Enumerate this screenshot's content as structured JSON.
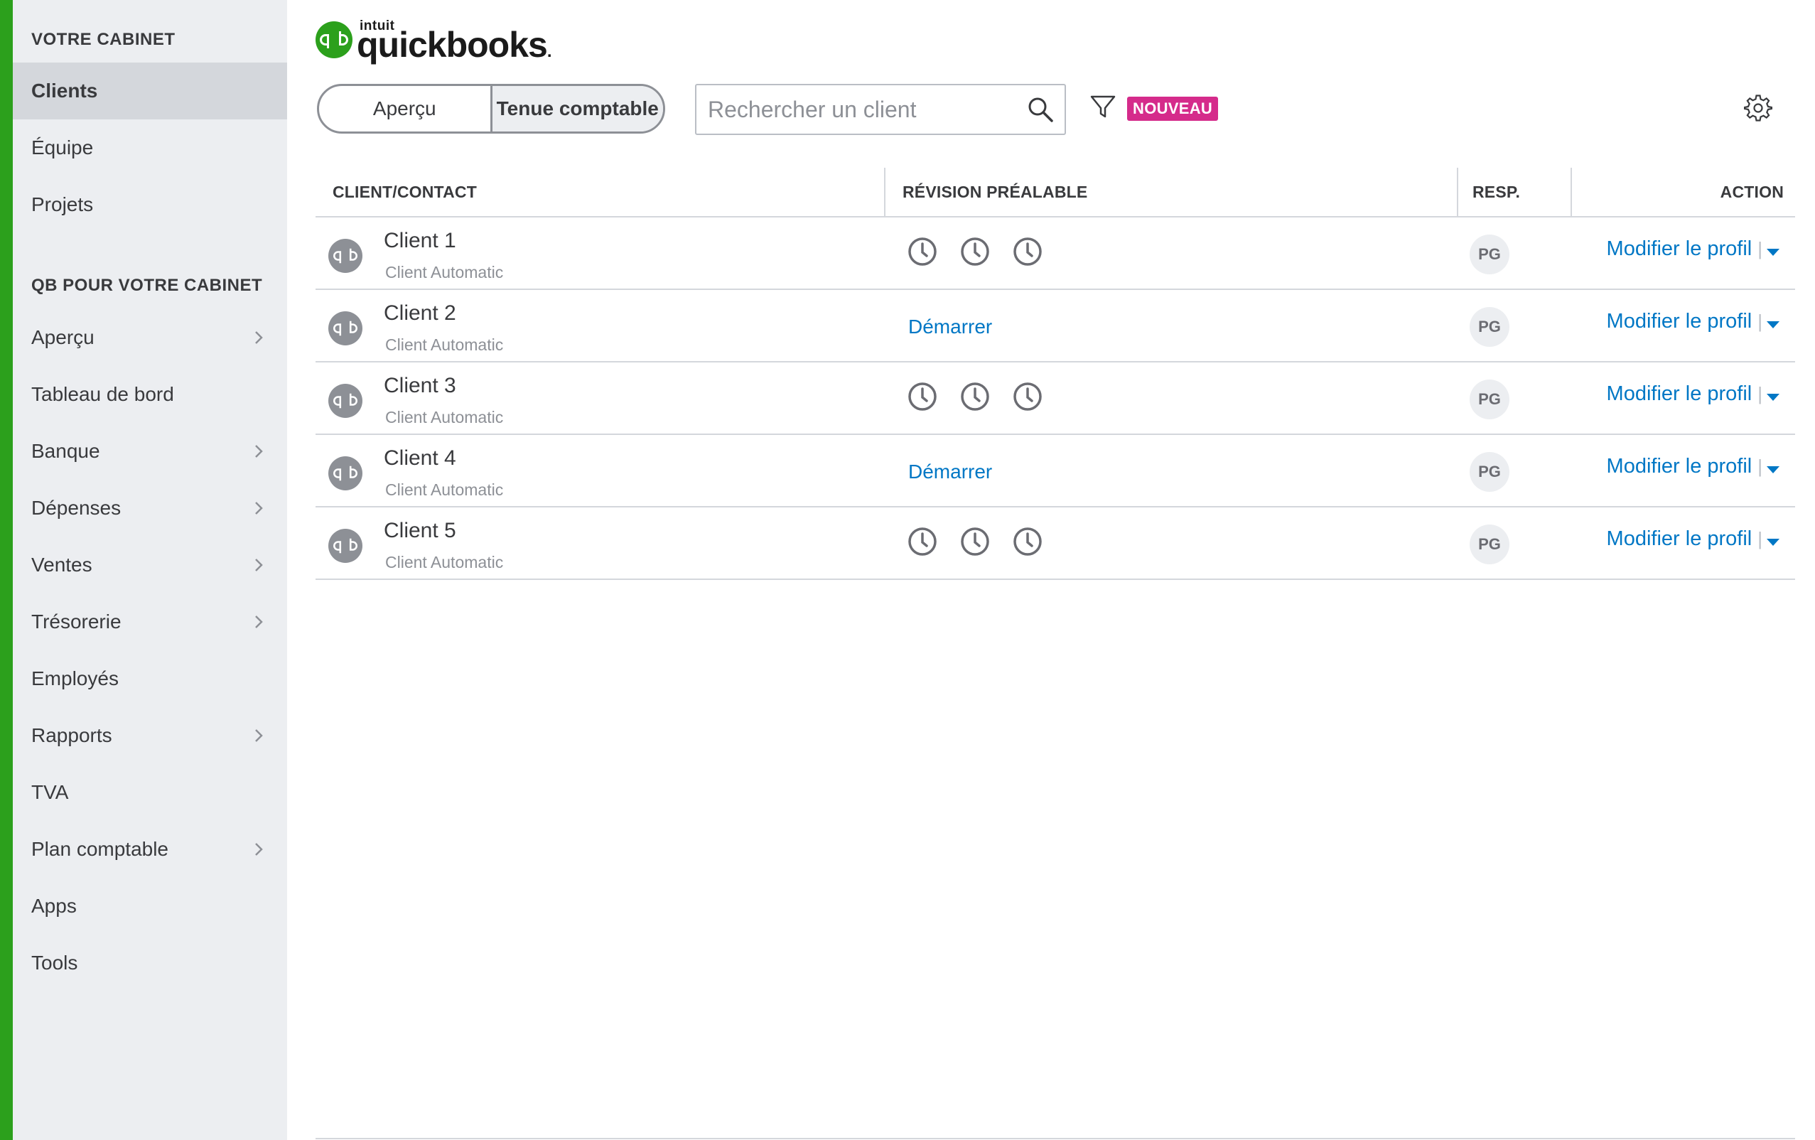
{
  "colors": {
    "brand": "#2ca01c",
    "link": "#0077c5",
    "badge": "#d52b8b",
    "sidebar_bg": "#eceef1"
  },
  "sidebar": {
    "section1": "VOTRE CABINET",
    "items1": [
      {
        "label": "Clients",
        "active": true,
        "chevron": false
      },
      {
        "label": "Équipe",
        "chevron": false
      },
      {
        "label": "Projets",
        "chevron": false
      }
    ],
    "section2": "QB POUR VOTRE CABINET",
    "items2": [
      {
        "label": "Aperçu",
        "chevron": true
      },
      {
        "label": "Tableau de bord",
        "chevron": false
      },
      {
        "label": "Banque",
        "chevron": true
      },
      {
        "label": "Dépenses",
        "chevron": true
      },
      {
        "label": "Ventes",
        "chevron": true
      },
      {
        "label": "Trésorerie",
        "chevron": true
      },
      {
        "label": "Employés",
        "chevron": false
      },
      {
        "label": "Rapports",
        "chevron": true
      },
      {
        "label": "TVA",
        "chevron": false
      },
      {
        "label": "Plan comptable",
        "chevron": true
      },
      {
        "label": "Apps",
        "chevron": false
      },
      {
        "label": "Tools",
        "chevron": false
      }
    ]
  },
  "header": {
    "logo_small": "intuit",
    "logo_main": "quickbooks",
    "logo_dot": ".",
    "toggle": [
      "Aperçu",
      "Tenue comptable"
    ],
    "search_placeholder": "Rechercher un client",
    "badge": "NOUVEAU",
    "icons": {
      "search": "search-icon",
      "filter": "filter-icon",
      "settings": "gear-icon"
    }
  },
  "table": {
    "headers": [
      "CLIENT/CONTACT",
      "RÉVISION PRÉALABLE",
      "RESP.",
      "ACTION"
    ],
    "rows": [
      {
        "name": "Client 1",
        "subtitle": "Client Automatic",
        "review": "clocks",
        "start_label": "",
        "resp": "PG",
        "action": "Modifier le profil"
      },
      {
        "name": "Client 2",
        "subtitle": "Client Automatic",
        "review": "start",
        "start_label": "Démarrer",
        "resp": "PG",
        "action": "Modifier le profil"
      },
      {
        "name": "Client 3",
        "subtitle": "Client Automatic",
        "review": "clocks",
        "start_label": "",
        "resp": "PG",
        "action": "Modifier le profil"
      },
      {
        "name": "Client 4",
        "subtitle": "Client Automatic",
        "review": "start",
        "start_label": "Démarrer",
        "resp": "PG",
        "action": "Modifier le profil"
      },
      {
        "name": "Client 5",
        "subtitle": "Client Automatic",
        "review": "clocks",
        "start_label": "",
        "resp": "PG",
        "action": "Modifier le profil"
      }
    ],
    "separator": "|"
  }
}
